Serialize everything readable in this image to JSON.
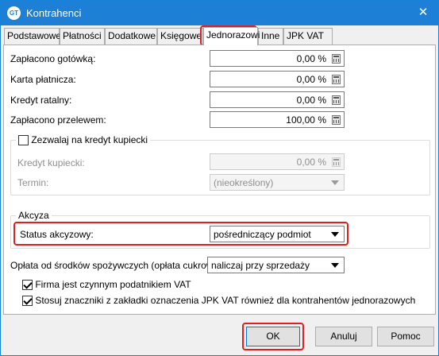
{
  "window": {
    "title": "Kontrahenci",
    "app_icon_text": "GT",
    "close_glyph": "✕"
  },
  "tabs": [
    {
      "label": "Podstawowe"
    },
    {
      "label": "Płatności"
    },
    {
      "label": "Dodatkowe"
    },
    {
      "label": "Księgowe"
    },
    {
      "label": "Jednorazowi",
      "active": true
    },
    {
      "label": "Inne"
    },
    {
      "label": "JPK VAT"
    }
  ],
  "payments": [
    {
      "label": "Zapłacono gotówką:",
      "value": "0,00 %"
    },
    {
      "label": "Karta płatnicza:",
      "value": "0,00 %"
    },
    {
      "label": "Kredyt ratalny:",
      "value": "0,00 %"
    },
    {
      "label": "Zapłacono przelewem:",
      "value": "100,00 %"
    }
  ],
  "merchant_credit": {
    "checkbox_label": "Zezwalaj na kredyt kupiecki",
    "checked": false,
    "credit_label": "Kredyt kupiecki:",
    "credit_value": "0,00 %",
    "term_label": "Termin:",
    "term_value": "(nieokreślony)"
  },
  "excise": {
    "group_title": "Akcyza",
    "status_label": "Status akcyzowy:",
    "status_value": "pośredniczący podmiot"
  },
  "sugar_fee": {
    "label": "Opłata od środków spożywczych (opłata cukrowa):",
    "value": "naliczaj przy sprzedaży"
  },
  "options": [
    {
      "label": "Firma jest czynnym podatnikiem VAT",
      "checked": true
    },
    {
      "label": "Stosuj znaczniki z zakładki oznaczenia JPK VAT również dla kontrahentów jednorazowych",
      "checked": true
    }
  ],
  "buttons": {
    "ok": "OK",
    "cancel": "Anuluj",
    "help": "Pomoc"
  },
  "colors": {
    "titlebar": "#1e7fd6",
    "highlight": "#e02020"
  },
  "icons": [
    "app-logo-icon",
    "close-icon",
    "calculator-icon",
    "chevron-down-icon",
    "checkbox-icon"
  ]
}
